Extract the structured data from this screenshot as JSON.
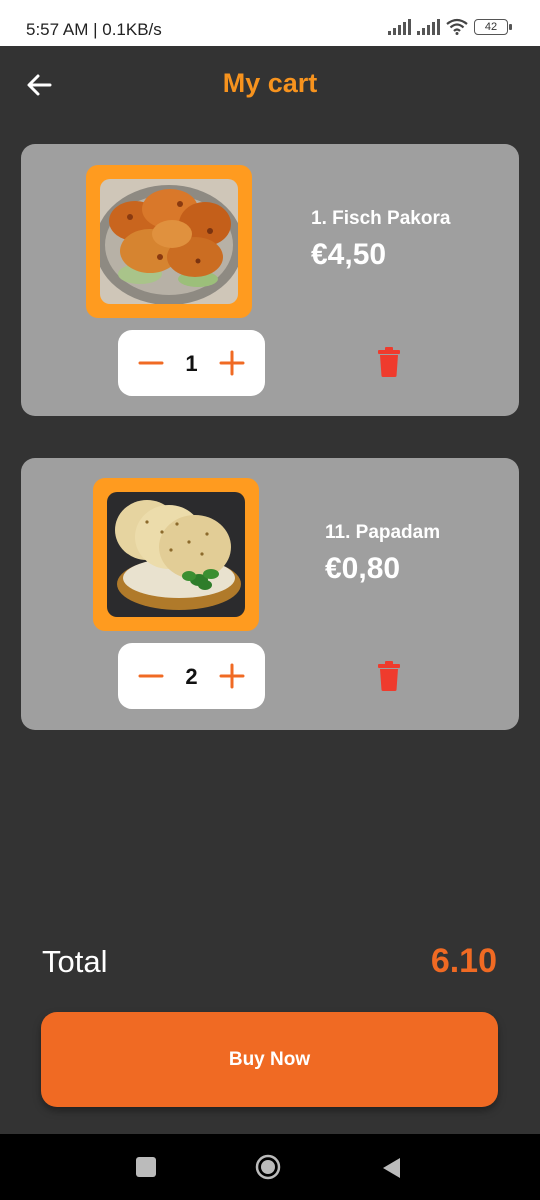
{
  "status_bar": {
    "text": "5:57 AM | 0.1KB/s",
    "battery": "42"
  },
  "header": {
    "title": "My cart",
    "back_icon": "arrow-left-icon"
  },
  "cart": {
    "items": [
      {
        "name": "1. Fisch Pakora",
        "price": "€4,50",
        "quantity": "1",
        "image": "fried-fish-pakora-photo"
      },
      {
        "name": "11. Papadam",
        "price": "€0,80",
        "quantity": "2",
        "image": "papadam-basket-photo"
      }
    ]
  },
  "summary": {
    "total_label": "Total",
    "total_value": "6.10"
  },
  "actions": {
    "buy_label": "Buy Now"
  },
  "colors": {
    "accent_orange": "#f06a23",
    "title_orange": "#f7931e",
    "frame_orange": "#ff9b1f",
    "delete_red": "#ef3b2d",
    "background": "#333333",
    "card": "#9f9f9f"
  }
}
